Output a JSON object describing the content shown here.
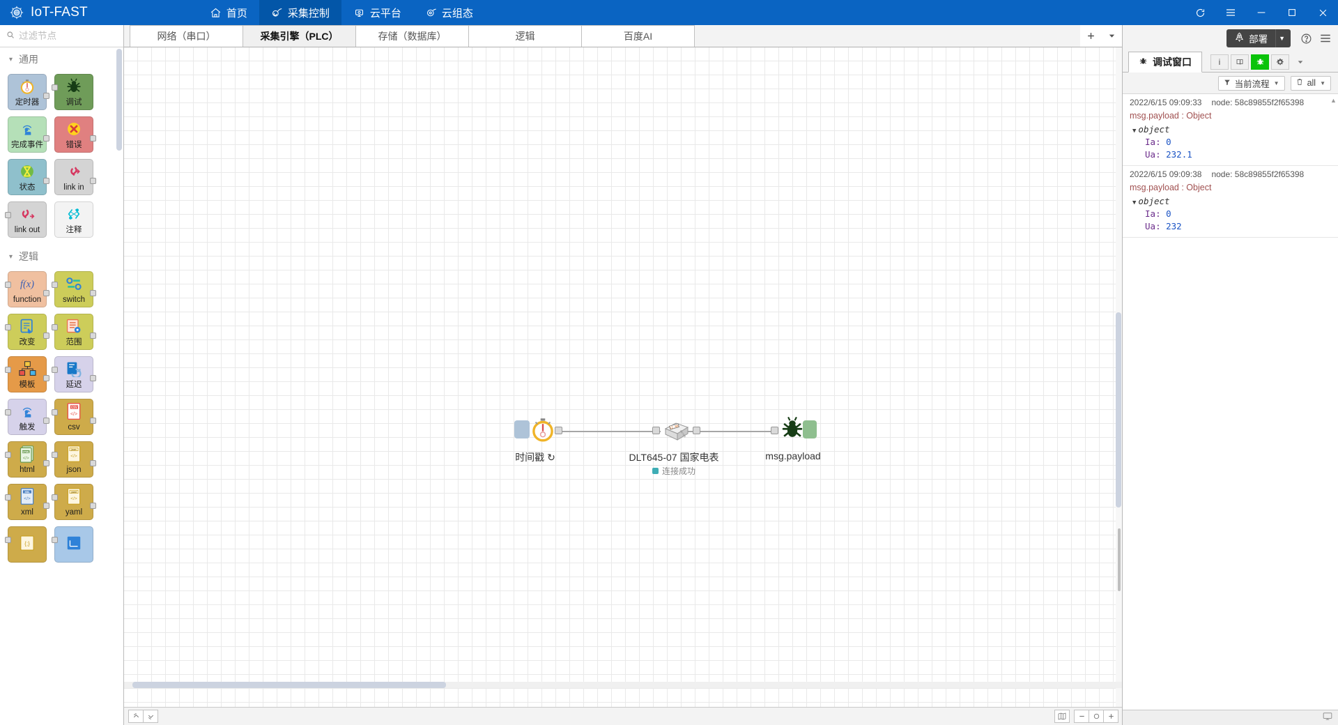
{
  "titlebar": {
    "brand": "IoT-FAST",
    "brand_icon": "gear-logo-icon",
    "nav": [
      {
        "label": "首页",
        "icon": "home-icon",
        "active": false
      },
      {
        "label": "采集控制",
        "icon": "collect-icon",
        "active": true
      },
      {
        "label": "云平台",
        "icon": "cloud-platform-icon",
        "active": false
      },
      {
        "label": "云组态",
        "icon": "cloud-config-icon",
        "active": false
      }
    ],
    "window_controls": [
      {
        "name": "refresh-icon",
        "glyph": "⟳"
      },
      {
        "name": "menu-icon",
        "glyph": "☰"
      },
      {
        "name": "minimize-icon",
        "glyph": "—"
      },
      {
        "name": "maximize-icon",
        "glyph": "☐"
      },
      {
        "name": "close-icon",
        "glyph": "✕"
      }
    ]
  },
  "palette": {
    "search_placeholder": "过滤节点",
    "search_value": "",
    "search_icon": "search-icon",
    "categories": [
      {
        "name": "通用",
        "collapse_icon": "chevron-down-icon",
        "nodes": [
          {
            "label": "定时器",
            "icon": "stopwatch-icon",
            "color": "#aec3d8",
            "ports": "out"
          },
          {
            "label": "调试",
            "icon": "bug-icon",
            "color": "#6f9c59",
            "ports": "in"
          },
          {
            "label": "完成事件",
            "icon": "touch-signal-icon",
            "color": "#b5e0b8",
            "ports": "out"
          },
          {
            "label": "错误",
            "icon": "error-x-icon",
            "color": "#e08080",
            "ports": "out"
          },
          {
            "label": "状态",
            "icon": "hourglass-icon",
            "color": "#8fc0cc",
            "ports": "out"
          },
          {
            "label": "link in",
            "icon": "link-in-icon",
            "color": "#d4d4d4",
            "ports": "out"
          },
          {
            "label": "link out",
            "icon": "link-out-icon",
            "color": "#d4d4d4",
            "ports": "in"
          },
          {
            "label": "注释",
            "icon": "comment-icon",
            "color": "#f3f3f3",
            "ports": "none"
          }
        ]
      },
      {
        "name": "逻辑",
        "collapse_icon": "chevron-down-icon",
        "nodes": [
          {
            "label": "function",
            "icon": "fx-icon",
            "color": "#f0c0a0",
            "ports": "both"
          },
          {
            "label": "switch",
            "icon": "switch-icon",
            "color": "#cdcd5a",
            "ports": "both"
          },
          {
            "label": "改变",
            "icon": "change-icon",
            "color": "#cdcd5a",
            "ports": "both"
          },
          {
            "label": "范围",
            "icon": "range-icon",
            "color": "#cdcd5a",
            "ports": "both"
          },
          {
            "label": "模板",
            "icon": "template-icon",
            "color": "#e59a48",
            "ports": "both"
          },
          {
            "label": "延迟",
            "icon": "delay-icon",
            "color": "#d6d2ea",
            "ports": "both"
          },
          {
            "label": "触发",
            "icon": "trigger-icon",
            "color": "#d6d2ea",
            "ports": "both"
          },
          {
            "label": "csv",
            "icon": "csv-icon",
            "color": "#ceab4a",
            "ports": "both"
          },
          {
            "label": "html",
            "icon": "html-icon",
            "color": "#ceab4a",
            "ports": "both"
          },
          {
            "label": "json",
            "icon": "json-icon",
            "color": "#ceab4a",
            "ports": "both"
          },
          {
            "label": "xml",
            "icon": "xml-icon",
            "color": "#ceab4a",
            "ports": "both"
          },
          {
            "label": "yaml",
            "icon": "yaml-icon",
            "color": "#ceab4a",
            "ports": "both"
          }
        ]
      }
    ]
  },
  "flow_tabs": {
    "tabs": [
      {
        "label": "网络（串口）",
        "active": false
      },
      {
        "label": "采集引擎（PLC）",
        "active": true
      },
      {
        "label": "存储（数据库）",
        "active": false
      },
      {
        "label": "逻辑",
        "active": false
      },
      {
        "label": "百度AI",
        "active": false
      }
    ],
    "add_label": "+",
    "add_icon": "plus-icon",
    "menu_icon": "chevron-down-icon"
  },
  "canvas": {
    "nodes": [
      {
        "name": "inject-node",
        "label": "时间戳 ↻",
        "icon": "stopwatch-icon",
        "status": null
      },
      {
        "name": "dlt645-node",
        "label": "DLT645-07 国家电表",
        "icon": "meter-icon",
        "status": "连接成功",
        "status_color": "#3FADB5"
      },
      {
        "name": "debug-node",
        "label": "msg.payload",
        "icon": "bug-icon",
        "status": null
      }
    ],
    "bottom_left_buttons": [
      {
        "name": "collapse-all-button",
        "glyph": "⌃"
      },
      {
        "name": "expand-all-button",
        "glyph": "⌄"
      }
    ],
    "bottom_right_buttons": [
      {
        "name": "navigator-button",
        "glyph": "⌷"
      },
      {
        "name": "zoom-out-button",
        "glyph": "−"
      },
      {
        "name": "zoom-reset-button",
        "glyph": "○"
      },
      {
        "name": "zoom-in-button",
        "glyph": "＋"
      }
    ]
  },
  "sidebar": {
    "deploy": {
      "label": "部署",
      "icon": "rocket-icon",
      "caret": "▼"
    },
    "help_icon": "help-icon",
    "menu_icon": "hamburger-icon",
    "tab": {
      "label": "调试窗口",
      "icon": "bug-icon"
    },
    "tab_buttons": [
      {
        "name": "info-tab-button",
        "glyph": "i",
        "active": false
      },
      {
        "name": "help-tab-button",
        "glyph": "📖",
        "active": false
      },
      {
        "name": "debug-tab-button",
        "glyph": "bug",
        "active": true
      },
      {
        "name": "config-tab-button",
        "glyph": "⚙",
        "active": false
      },
      {
        "name": "more-tab-button",
        "glyph": "▼",
        "active": false
      }
    ],
    "filters": {
      "scope": {
        "label": "当前流程",
        "icon": "filter-icon",
        "caret": "▼"
      },
      "clear": {
        "label": "all",
        "icon": "trash-icon",
        "caret": "▼"
      }
    },
    "messages": [
      {
        "time": "2022/6/15 09:09:33",
        "node": "node: 58c89855f2f65398",
        "topic": "msg.payload : Object",
        "object_label": "object",
        "props": [
          {
            "key": "Ia",
            "value": "0"
          },
          {
            "key": "Ua",
            "value": "232.1"
          }
        ]
      },
      {
        "time": "2022/6/15 09:09:38",
        "node": "node: 58c89855f2f65398",
        "topic": "msg.payload : Object",
        "object_label": "object",
        "props": [
          {
            "key": "Ia",
            "value": "0"
          },
          {
            "key": "Ua",
            "value": "232"
          }
        ]
      }
    ],
    "statusbar_icon": "monitor-icon"
  },
  "colors": {
    "titlebar": "#0a64c2",
    "titlebar_active": "#0356a8",
    "deploy_bg": "#444444",
    "debug_active": "#0ac30a",
    "status_dot": "#3FADB5"
  }
}
